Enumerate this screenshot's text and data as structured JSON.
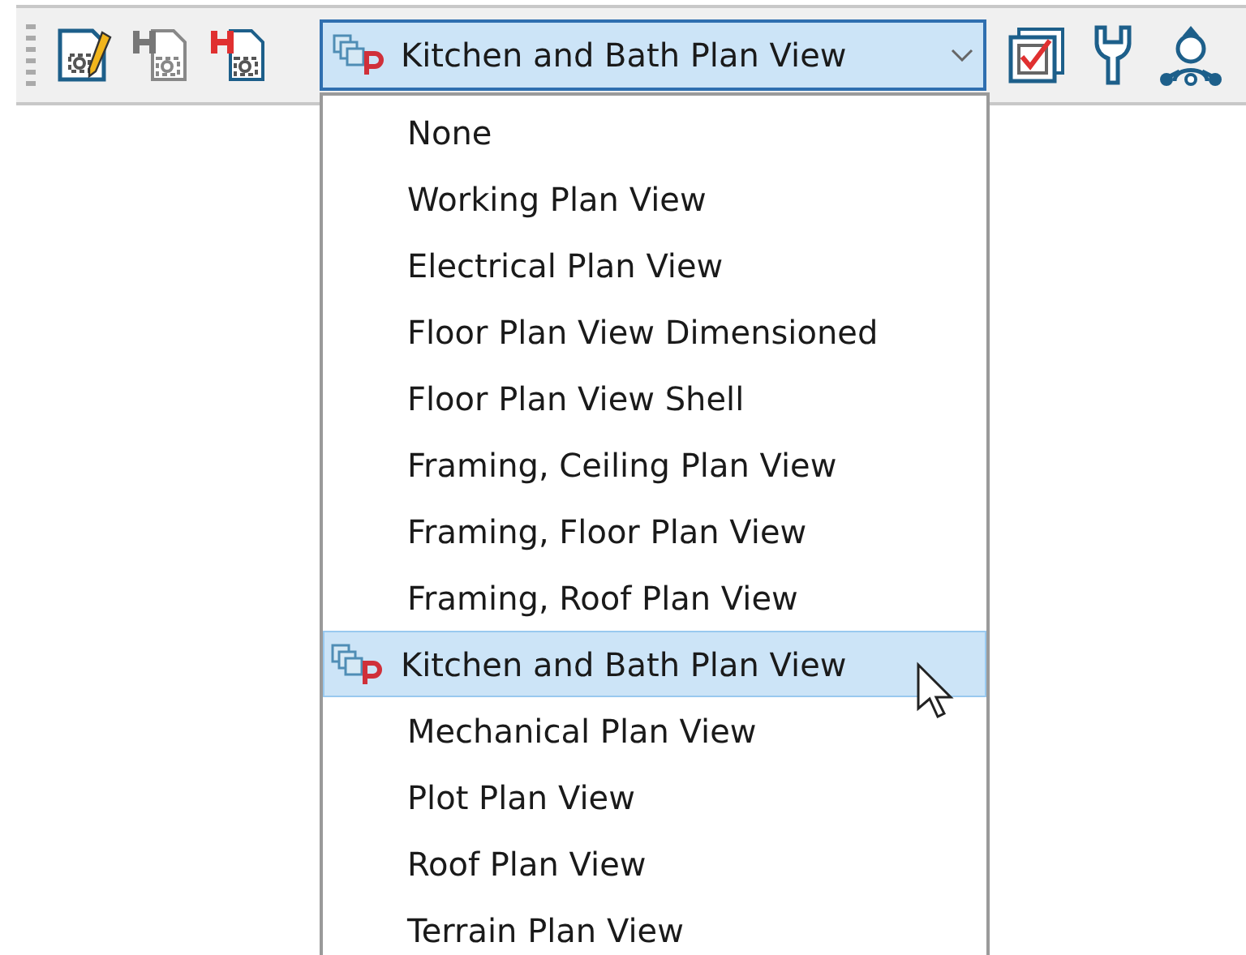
{
  "toolbar": {
    "combo": {
      "value": "Kitchen and Bath Plan View",
      "expanded": true
    }
  },
  "dropdown": {
    "items": [
      {
        "label": "None",
        "selected": false
      },
      {
        "label": "Working Plan View",
        "selected": false
      },
      {
        "label": "Electrical Plan View",
        "selected": false
      },
      {
        "label": "Floor Plan View Dimensioned",
        "selected": false
      },
      {
        "label": "Floor Plan View Shell",
        "selected": false
      },
      {
        "label": "Framing, Ceiling Plan View",
        "selected": false
      },
      {
        "label": "Framing, Floor Plan View",
        "selected": false
      },
      {
        "label": "Framing, Roof Plan View",
        "selected": false
      },
      {
        "label": "Kitchen and Bath Plan View",
        "selected": true
      },
      {
        "label": "Mechanical Plan View",
        "selected": false
      },
      {
        "label": "Plot Plan View",
        "selected": false
      },
      {
        "label": "Roof Plan View",
        "selected": false
      },
      {
        "label": "Terrain Plan View",
        "selected": false
      }
    ]
  }
}
